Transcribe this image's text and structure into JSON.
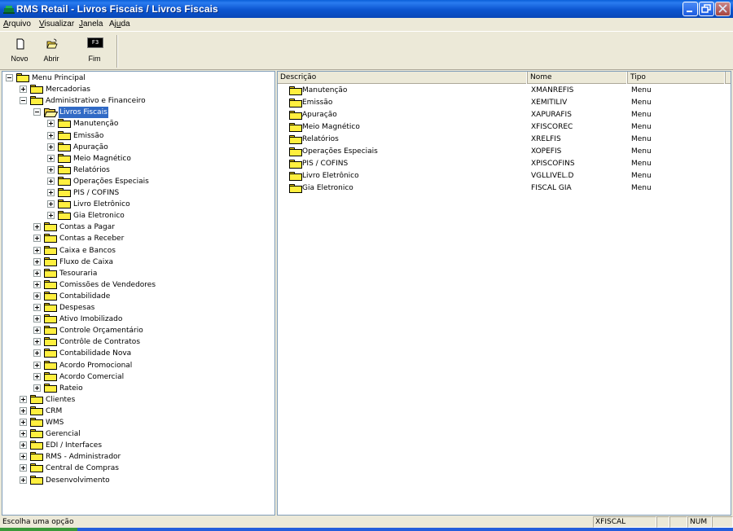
{
  "window": {
    "title": "RMS Retail - Livros Fiscais / Livros Fiscais"
  },
  "menubar": [
    {
      "pre": "",
      "u": "A",
      "post": "rquivo"
    },
    {
      "pre": "",
      "u": "V",
      "post": "isualizar"
    },
    {
      "pre": "",
      "u": "J",
      "post": "anela"
    },
    {
      "pre": "Aj",
      "u": "u",
      "post": "da"
    }
  ],
  "toolbar": {
    "novo_label": "Novo",
    "abrir_label": "Abrir",
    "fim_label": "Fim",
    "fim_key": "F3"
  },
  "tree": {
    "root": "Menu Principal",
    "level1a": [
      "Mercadorias",
      "Administrativo e Financeiro"
    ],
    "selected": "Livros Fiscais",
    "livros_children": [
      "Manutenção",
      "Emissão",
      "Apuração",
      "Meio Magnético",
      "Relatórios",
      "Operações Especiais",
      "PIS / COFINS",
      "Livro Eletrônico",
      "Gia Eletronico"
    ],
    "adm_children": [
      "Contas a Pagar",
      "Contas a Receber",
      "Caixa e Bancos",
      "Fluxo de Caixa",
      "Tesouraria",
      "Comissões de Vendedores",
      "Contabilidade",
      "Despesas",
      "Ativo Imobilizado",
      "Controle Orçamentário",
      "Contrôle de Contratos",
      "Contabilidade Nova",
      "Acordo Promocional",
      "Acordo Comercial",
      "Rateio"
    ],
    "level1b": [
      "Clientes",
      "CRM",
      "WMS",
      "Gerencial",
      "EDI / Interfaces",
      "RMS - Administrador",
      "Central de Compras",
      "Desenvolvimento"
    ]
  },
  "list": {
    "columns": [
      "Descrição",
      "Nome",
      "Tipo"
    ],
    "rows": [
      {
        "desc": "Manutenção",
        "nome": "XMANREFIS",
        "tipo": "Menu"
      },
      {
        "desc": "Emissão",
        "nome": "XEMITILIV",
        "tipo": "Menu"
      },
      {
        "desc": "Apuração",
        "nome": "XAPURAFIS",
        "tipo": "Menu"
      },
      {
        "desc": "Meio Magnético",
        "nome": "XFISCOREC",
        "tipo": "Menu"
      },
      {
        "desc": "Relatórios",
        "nome": "XRELFIS",
        "tipo": "Menu"
      },
      {
        "desc": "Operações Especiais",
        "nome": "XOPEFIS",
        "tipo": "Menu"
      },
      {
        "desc": "PIS / COFINS",
        "nome": "XPISCOFINS",
        "tipo": "Menu"
      },
      {
        "desc": "Livro Eletrônico",
        "nome": "VGLLIVEL.D",
        "tipo": "Menu"
      },
      {
        "desc": "Gia Eletronico",
        "nome": "FISCAL GIA",
        "tipo": "Menu"
      }
    ]
  },
  "status": {
    "message": "Escolha uma opção",
    "module": "XFISCAL",
    "num": "NUM"
  }
}
